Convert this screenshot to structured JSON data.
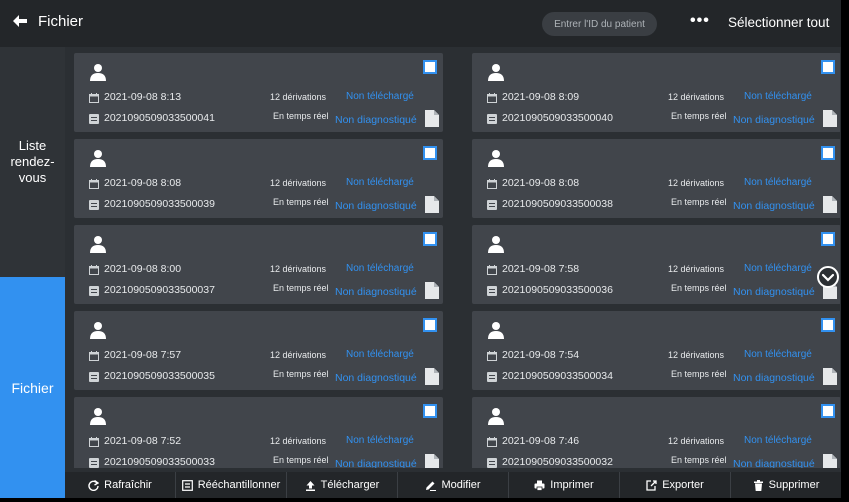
{
  "header": {
    "back_label": "Fichier",
    "search_placeholder": "Entrer l'ID du patient",
    "more_label": "•••",
    "select_all_label": "Sélectionner tout"
  },
  "sidebar": {
    "items": [
      {
        "label": "Liste rendez-vous"
      },
      {
        "label": "Fichier"
      }
    ]
  },
  "colors": {
    "accent": "#3291f0",
    "topbar": "#232629",
    "card": "#41454b",
    "background": "#2b2f33"
  },
  "records": [
    {
      "datetime": "2021-09-08 8:13",
      "id": "2021090509033500041",
      "leads": "12 dérivations",
      "mode": "En temps réel",
      "upload": "Non téléchargé",
      "diagnosis": "Non diagnostiqué",
      "checked": false
    },
    {
      "datetime": "2021-09-08 8:09",
      "id": "2021090509033500040",
      "leads": "12 dérivations",
      "mode": "En temps réel",
      "upload": "Non téléchargé",
      "diagnosis": "Non diagnostiqué",
      "checked": false
    },
    {
      "datetime": "2021-09-08 8:08",
      "id": "2021090509033500039",
      "leads": "12 dérivations",
      "mode": "En temps réel",
      "upload": "Non téléchargé",
      "diagnosis": "Non diagnostiqué",
      "checked": false
    },
    {
      "datetime": "2021-09-08 8:08",
      "id": "2021090509033500038",
      "leads": "12 dérivations",
      "mode": "En temps réel",
      "upload": "Non téléchargé",
      "diagnosis": "Non diagnostiqué",
      "checked": false
    },
    {
      "datetime": "2021-09-08 8:00",
      "id": "2021090509033500037",
      "leads": "12 dérivations",
      "mode": "En temps réel",
      "upload": "Non téléchargé",
      "diagnosis": "Non diagnostiqué",
      "checked": false
    },
    {
      "datetime": "2021-09-08 7:58",
      "id": "2021090509033500036",
      "leads": "12 dérivations",
      "mode": "En temps réel",
      "upload": "Non téléchargé",
      "diagnosis": "Non diagnostiqué",
      "checked": false
    },
    {
      "datetime": "2021-09-08 7:57",
      "id": "2021090509033500035",
      "leads": "12 dérivations",
      "mode": "En temps réel",
      "upload": "Non téléchargé",
      "diagnosis": "Non diagnostiqué",
      "checked": false
    },
    {
      "datetime": "2021-09-08 7:54",
      "id": "2021090509033500034",
      "leads": "12 dérivations",
      "mode": "En temps réel",
      "upload": "Non téléchargé",
      "diagnosis": "Non diagnostiqué",
      "checked": false
    },
    {
      "datetime": "2021-09-08 7:52",
      "id": "2021090509033500033",
      "leads": "12 dérivations",
      "mode": "En temps réel",
      "upload": "Non téléchargé",
      "diagnosis": "Non diagnostiqué",
      "checked": false
    },
    {
      "datetime": "2021-09-08 7:46",
      "id": "2021090509033500032",
      "leads": "12 dérivations",
      "mode": "En temps réel",
      "upload": "Non téléchargé",
      "diagnosis": "Non diagnostiqué",
      "checked": false
    }
  ],
  "toolbar": {
    "items": [
      {
        "label": "Rafraîchir",
        "icon": "refresh-icon"
      },
      {
        "label": "Rééchantillonner",
        "icon": "resample-icon"
      },
      {
        "label": "Télécharger",
        "icon": "upload-icon"
      },
      {
        "label": "Modifier",
        "icon": "edit-icon"
      },
      {
        "label": "Imprimer",
        "icon": "print-icon"
      },
      {
        "label": "Exporter",
        "icon": "export-icon"
      },
      {
        "label": "Supprimer",
        "icon": "trash-icon"
      }
    ]
  }
}
